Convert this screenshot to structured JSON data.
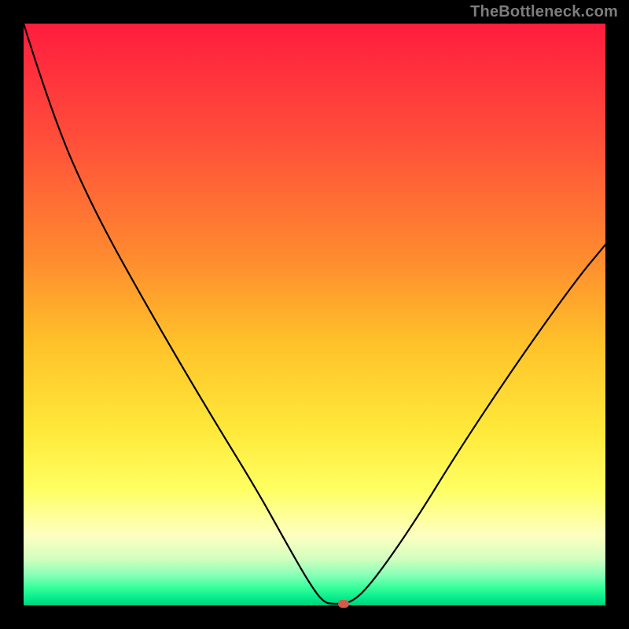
{
  "attribution": "TheBottleneck.com",
  "colors": {
    "page_bg": "#000000",
    "marker": "#d45a4a",
    "attribution_text": "#7d7d7d",
    "gradient_top": "#ff1c3e",
    "gradient_bottom": "#00d07a"
  },
  "chart_data": {
    "type": "line",
    "title": "",
    "xlabel": "",
    "ylabel": "",
    "xlim": [
      0,
      100
    ],
    "ylim": [
      0,
      100
    ],
    "grid": false,
    "series": [
      {
        "name": "bottleneck-curve",
        "x": [
          0,
          5,
          12,
          22,
          32,
          40,
          45,
          49,
          51.5,
          53.5,
          56.5,
          60,
          67,
          75,
          85,
          95,
          100
        ],
        "y": [
          100,
          84,
          68,
          50,
          33,
          20,
          11,
          4,
          0.5,
          0.2,
          0.5,
          4,
          14,
          27,
          42,
          56,
          62
        ]
      }
    ],
    "annotations": [
      {
        "name": "min-marker",
        "x": 55,
        "y": 0.3,
        "shape": "pill",
        "color": "#d45a4a"
      }
    ]
  }
}
